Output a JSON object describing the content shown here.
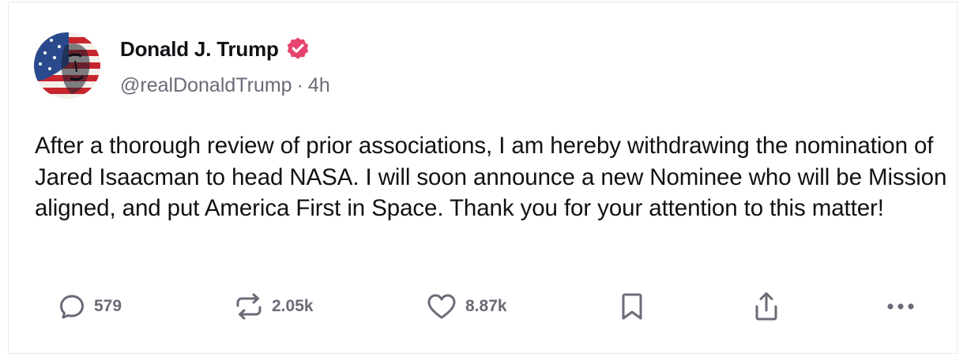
{
  "post": {
    "author_name": "Donald J. Trump",
    "handle": "@realDonaldTrump",
    "separator": "·",
    "time_ago": "4h",
    "verified_icon": "verified-badge-icon",
    "body": "After a thorough review of prior associations, I am hereby withdrawing the nomination of Jared Isaacman to head NASA. I will soon announce a new Nominee who will be Mission aligned, and put America First in Space. Thank you for your attention to this matter!"
  },
  "actions": {
    "replies": {
      "icon": "reply-icon",
      "count": "579"
    },
    "retruths": {
      "icon": "repost-icon",
      "count": "2.05k"
    },
    "likes": {
      "icon": "heart-icon",
      "count": "8.87k"
    },
    "bookmark": {
      "icon": "bookmark-icon"
    },
    "share": {
      "icon": "share-icon"
    },
    "more": {
      "icon": "more-dots-icon"
    }
  },
  "colors": {
    "text_primary": "#111116",
    "text_secondary": "#6b6b78",
    "verified": "#e8436d",
    "border": "#e8e8ec"
  }
}
